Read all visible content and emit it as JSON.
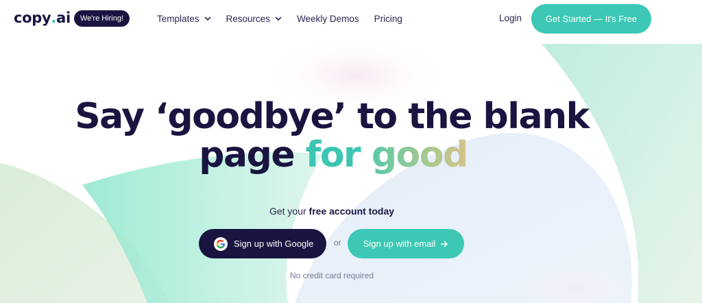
{
  "header": {
    "logo_text": "copy",
    "logo_dot": ".",
    "logo_suffix": "ai",
    "hiring_badge": "We're Hiring!",
    "nav": [
      {
        "label": "Templates",
        "has_dropdown": true
      },
      {
        "label": "Resources",
        "has_dropdown": true
      },
      {
        "label": "Weekly Demos",
        "has_dropdown": false
      },
      {
        "label": "Pricing",
        "has_dropdown": false
      }
    ],
    "login": "Login",
    "cta": "Get Started — It's Free"
  },
  "hero": {
    "headline_line1": "Say ‘goodbye’ to the blank",
    "headline_line2_a": "page",
    "headline_line2_b": "for",
    "headline_line2_c": "good",
    "sub_prefix": "Get your",
    "sub_bold": "free account today",
    "google_button": "Sign up with Google",
    "or": "or",
    "email_button": "Sign up with email",
    "no_credit_card": "No credit card required"
  },
  "colors": {
    "navy": "#1a1440",
    "teal": "#3cc8b4",
    "text": "#2a2550",
    "muted": "#7a7890"
  },
  "icons": {
    "chevron": "chevron-down-icon",
    "google": "google-icon",
    "arrow": "arrow-right-icon"
  }
}
